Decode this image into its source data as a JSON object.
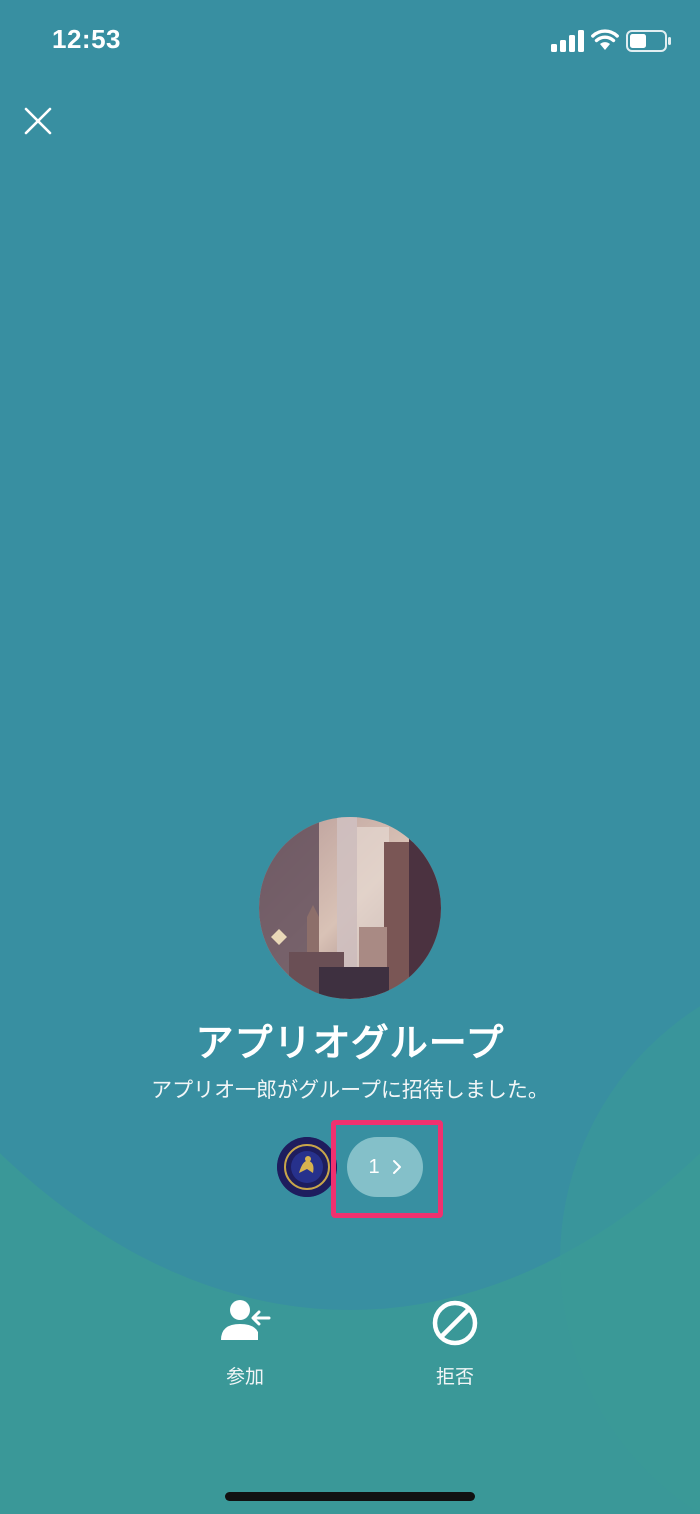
{
  "status_bar": {
    "time": "12:53",
    "icons": [
      "signal-icon",
      "wifi-icon",
      "battery-icon"
    ]
  },
  "header": {
    "close_icon": "close-icon"
  },
  "group": {
    "name": "アプリオグループ",
    "invite_message": "アプリオ一郎がグループに招待しました。",
    "member_count": "1"
  },
  "actions": {
    "join_label": "参加",
    "reject_label": "拒否"
  },
  "colors": {
    "background_primary": "#388fa1",
    "background_secondary": "#3a9898",
    "highlight": "#f0316f",
    "member_pill": "#84c0c9"
  }
}
